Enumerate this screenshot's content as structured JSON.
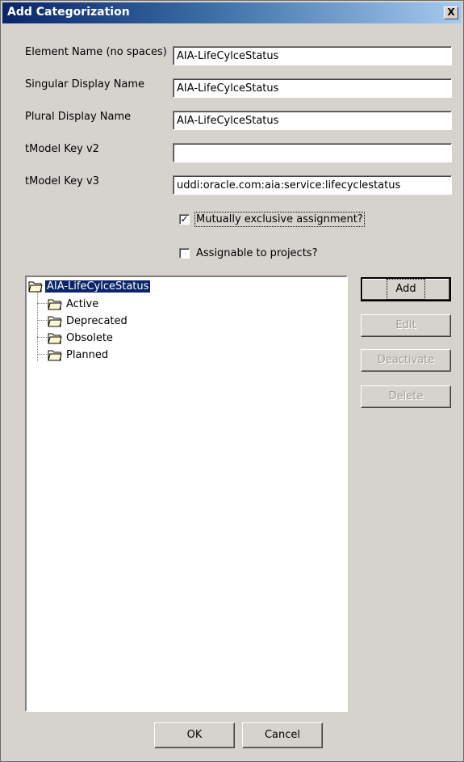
{
  "window": {
    "title": "Add Categorization",
    "close_glyph": "X"
  },
  "form": {
    "element_name": {
      "label": "Element Name (no spaces)",
      "value": "AIA-LifeCylceStatus"
    },
    "singular_name": {
      "label": "Singular Display Name",
      "value": "AIA-LifeCylceStatus"
    },
    "plural_name": {
      "label": "Plural Display Name",
      "value": "AIA-LifeCylceStatus"
    },
    "tmodel_v2": {
      "label": "tModel Key v2",
      "value": ""
    },
    "tmodel_v3": {
      "label": "tModel Key v3",
      "value": "uddi:oracle.com:aia:service:lifecyclestatus"
    }
  },
  "checkboxes": {
    "mutually_exclusive": {
      "label": "Mutually exclusive assignment?",
      "checked": true,
      "mark": "✓"
    },
    "assignable_projects": {
      "label": "Assignable to projects?",
      "checked": false,
      "mark": ""
    }
  },
  "tree": {
    "root": "AIA-LifeCylceStatus",
    "children": [
      "Active",
      "Deprecated",
      "Obsolete",
      "Planned"
    ]
  },
  "side_buttons": {
    "add": "Add",
    "edit": "Edit",
    "deactivate": "Deactivate",
    "delete": "Delete"
  },
  "footer": {
    "ok": "OK",
    "cancel": "Cancel"
  },
  "icons": {
    "folder": "folder-icon",
    "close": "close-icon",
    "check": "checkbox-icon"
  },
  "colors": {
    "title_gradient_start": "#0a246a",
    "title_gradient_end": "#a6caf0",
    "selection": "#0a246a",
    "dialog_face": "#d6d3ce"
  }
}
